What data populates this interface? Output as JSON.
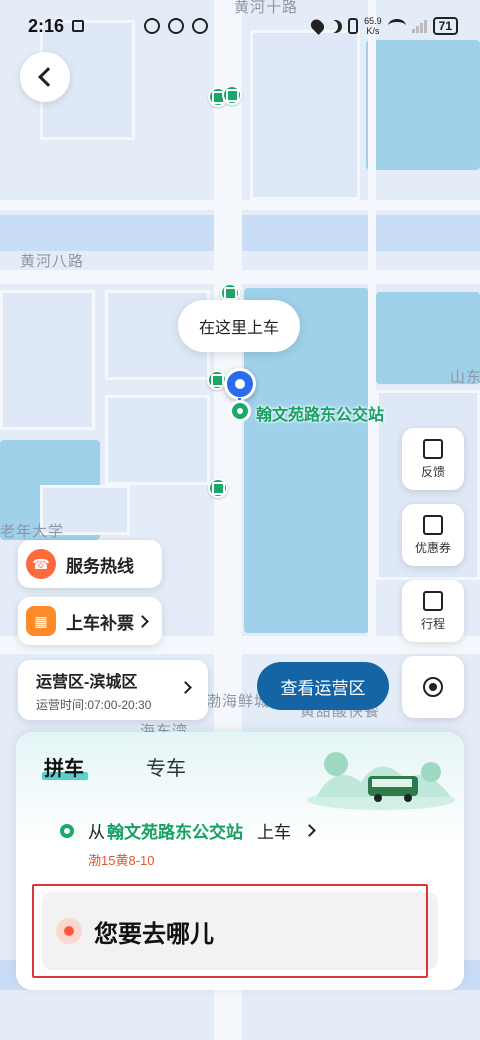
{
  "status_bar": {
    "time": "2:16",
    "speed_value": "65.9",
    "speed_unit": "K/s",
    "battery": "71"
  },
  "map": {
    "labels": {
      "top_road": "黄河十路",
      "mid_road": "黄河八路",
      "left_school": "老年大学",
      "right_label": "山东",
      "bottom_mid": "渤海鲜城",
      "bottom_right": "黄甜酸快餐",
      "bottom_left_road": "海东湾"
    },
    "pickup_hint": "在这里上车",
    "station_name": "翰文苑路东公交站"
  },
  "side_buttons": {
    "feedback": "反馈",
    "coupons": "优惠券",
    "trips": "行程"
  },
  "service_hotline": "服务热线",
  "fare_supplement": "上车补票",
  "zone": {
    "title": "运营区-滨城区",
    "hours": "运营时间:07:00-20:30",
    "view_button": "查看运营区"
  },
  "sheet": {
    "tab_carpool": "拼车",
    "tab_private": "专车",
    "pickup_prefix": "从",
    "pickup_station": "翰文苑路东公交站",
    "pickup_suffix": "上车",
    "plate": "渤15黄8-10",
    "destination_placeholder": "您要去哪儿"
  },
  "colors": {
    "accent_green": "#1aa869",
    "pin_blue": "#2a6cf0",
    "button_blue": "#1565a6",
    "orange": "#ff6a3d",
    "highlight_red": "#d9363a"
  },
  "icons": [
    "back-arrow-icon",
    "bus-stop-icon",
    "location-pin-icon",
    "edit-icon",
    "ticket-icon",
    "calendar-icon",
    "locate-icon",
    "phone-icon",
    "ticket-booth-icon",
    "chevron-right-icon"
  ]
}
